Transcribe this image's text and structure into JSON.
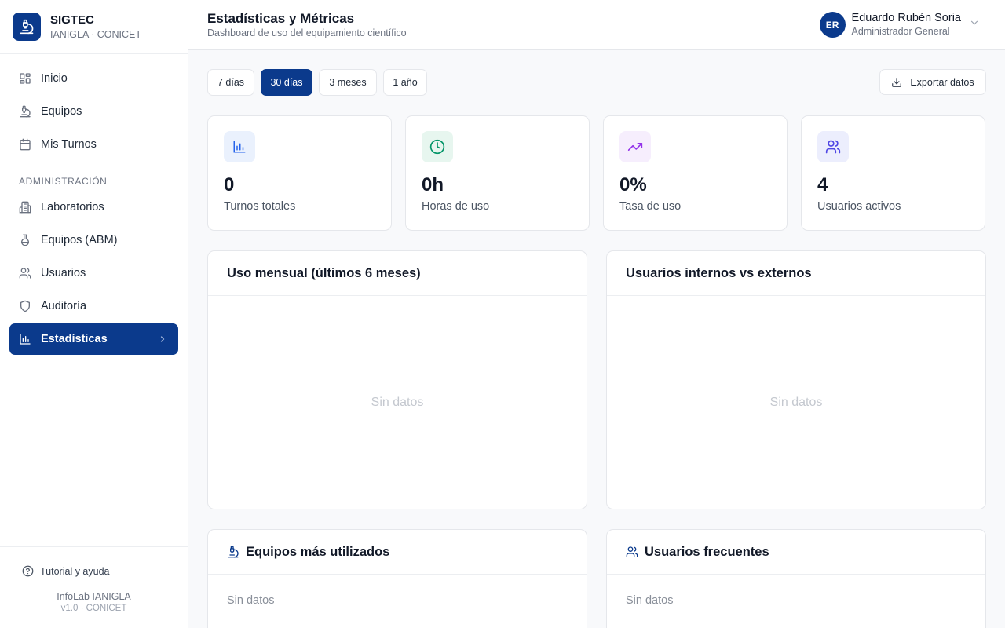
{
  "brand": {
    "title": "SIGTEC",
    "subtitle": "IANIGLA · CONICET"
  },
  "sidebar": {
    "items": [
      {
        "label": "Inicio",
        "icon": "grid-icon"
      },
      {
        "label": "Equipos",
        "icon": "microscope-icon"
      },
      {
        "label": "Mis Turnos",
        "icon": "calendar-icon"
      }
    ],
    "section_admin": "ADMINISTRACIÓN",
    "admin_items": [
      {
        "label": "Laboratorios",
        "icon": "building-icon"
      },
      {
        "label": "Equipos (ABM)",
        "icon": "flask-icon"
      },
      {
        "label": "Usuarios",
        "icon": "users-icon"
      },
      {
        "label": "Auditoría",
        "icon": "shield-icon"
      },
      {
        "label": "Estadísticas",
        "icon": "bar-chart-icon",
        "active": true
      }
    ],
    "help_label": "Tutorial y ayuda",
    "footer_line1": "InfoLab IANIGLA",
    "footer_line2": "v1.0 · CONICET"
  },
  "header": {
    "title": "Estadísticas y Métricas",
    "subtitle": "Dashboard de uso del equipamiento científico",
    "user": {
      "initials": "ER",
      "name": "Eduardo Rubén Soria",
      "role": "Administrador General"
    }
  },
  "toolbar": {
    "ranges": [
      "7 días",
      "30 días",
      "3 meses",
      "1 año"
    ],
    "selected_range": "30 días",
    "export_label": "Exportar datos"
  },
  "kpis": [
    {
      "value": "0",
      "label": "Turnos totales",
      "icon": "bar-chart-icon",
      "color": "#2563eb",
      "bg": "#eaf1fd"
    },
    {
      "value": "0h",
      "label": "Horas de uso",
      "icon": "clock-icon",
      "color": "#059669",
      "bg": "#e7f6ef"
    },
    {
      "value": "0%",
      "label": "Tasa de uso",
      "icon": "trending-up-icon",
      "color": "#9333ea",
      "bg": "#f6eefd"
    },
    {
      "value": "4",
      "label": "Usuarios activos",
      "icon": "users-icon",
      "color": "#4f46e5",
      "bg": "#eceefd"
    }
  ],
  "panels": {
    "monthly": {
      "title": "Uso mensual (últimos 6 meses)",
      "empty": "Sin datos"
    },
    "internal_external": {
      "title": "Usuarios internos vs externos",
      "empty": "Sin datos"
    },
    "top_equipment": {
      "title": "Equipos más utilizados",
      "empty": "Sin datos"
    },
    "frequent_users": {
      "title": "Usuarios frecuentes",
      "empty": "Sin datos"
    }
  },
  "colors": {
    "primary": "#0b3a8c"
  }
}
